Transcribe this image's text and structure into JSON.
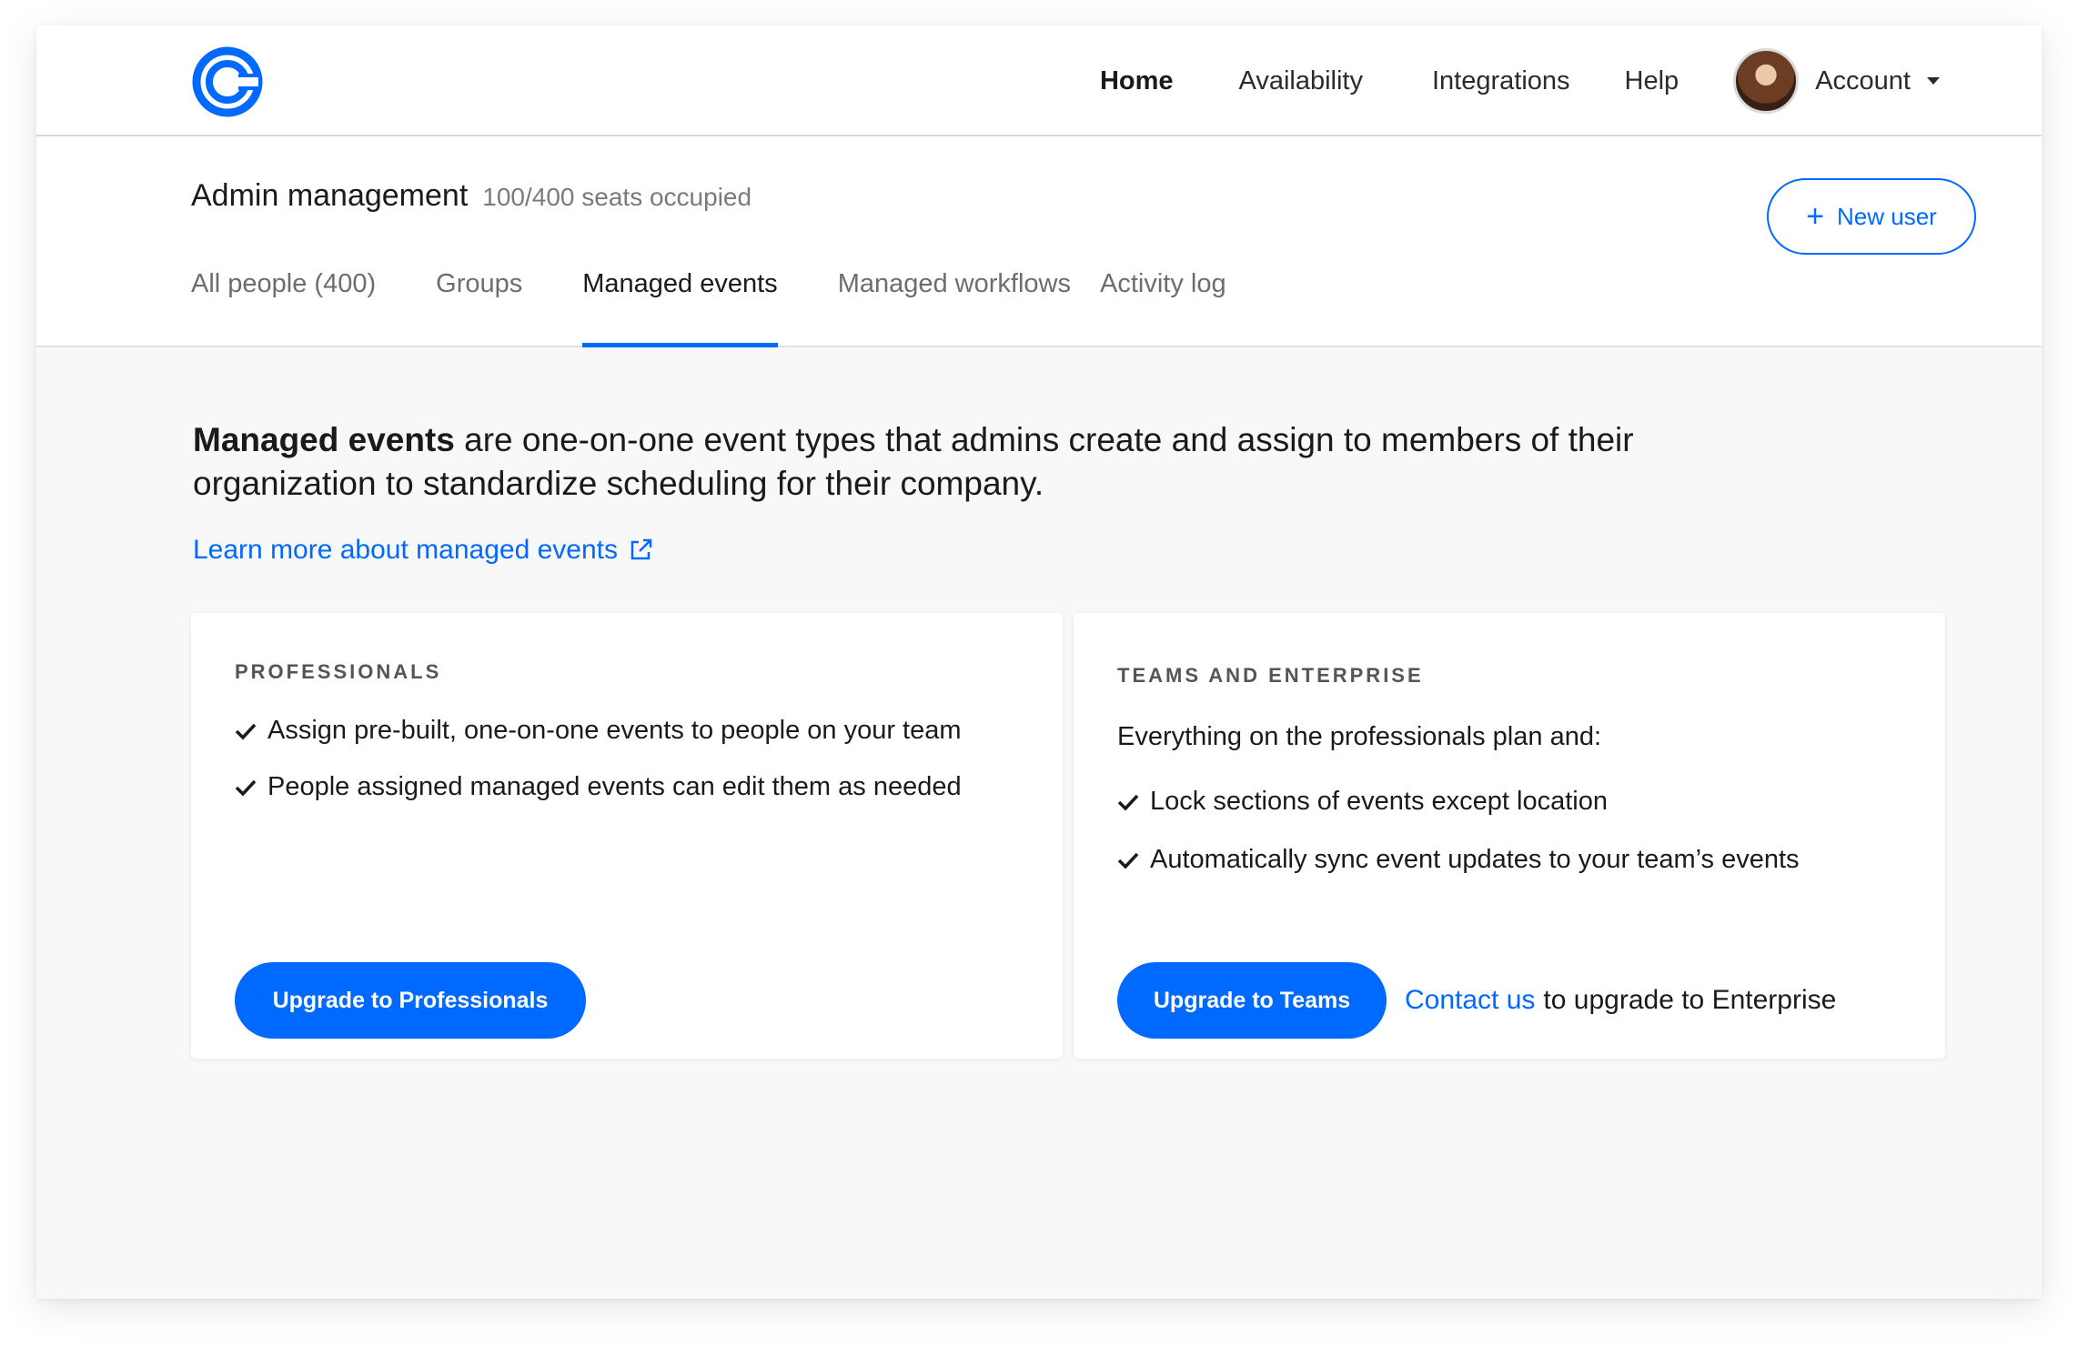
{
  "nav": {
    "items": [
      {
        "label": "Home"
      },
      {
        "label": "Availability"
      },
      {
        "label": "Integrations"
      },
      {
        "label": "Help"
      }
    ],
    "account_label": "Account"
  },
  "admin": {
    "title": "Admin management",
    "seats": "100/400 seats occupied",
    "new_user_label": "New user",
    "tabs": [
      {
        "label": "All people (400)"
      },
      {
        "label": "Groups"
      },
      {
        "label": "Managed events"
      },
      {
        "label": "Managed workflows"
      },
      {
        "label": "Activity log"
      }
    ],
    "active_tab": "Managed events"
  },
  "intro": {
    "bold": "Managed events",
    "text": " are one-on-one event types that admins create and assign to members of their organization to standardize scheduling for their company.",
    "learn_more": "Learn more about managed events"
  },
  "cards": {
    "professionals": {
      "heading": "PROFESSIONALS",
      "features": [
        "Assign pre-built, one-on-one events to people on your team",
        "People assigned managed events can edit them as needed"
      ],
      "button": "Upgrade to Professionals"
    },
    "teams": {
      "heading": "TEAMS AND ENTERPRISE",
      "subtitle": "Everything on the professionals plan and:",
      "features": [
        "Lock sections of events except location",
        "Automatically sync event updates to your team’s events"
      ],
      "button": "Upgrade to Teams",
      "contact_link": "Contact us",
      "contact_text": "to upgrade to Enterprise"
    }
  },
  "colors": {
    "accent": "#0069ff",
    "background": "#f8f8f8",
    "text": "#1a1a1a",
    "muted": "#6d6d6d"
  }
}
